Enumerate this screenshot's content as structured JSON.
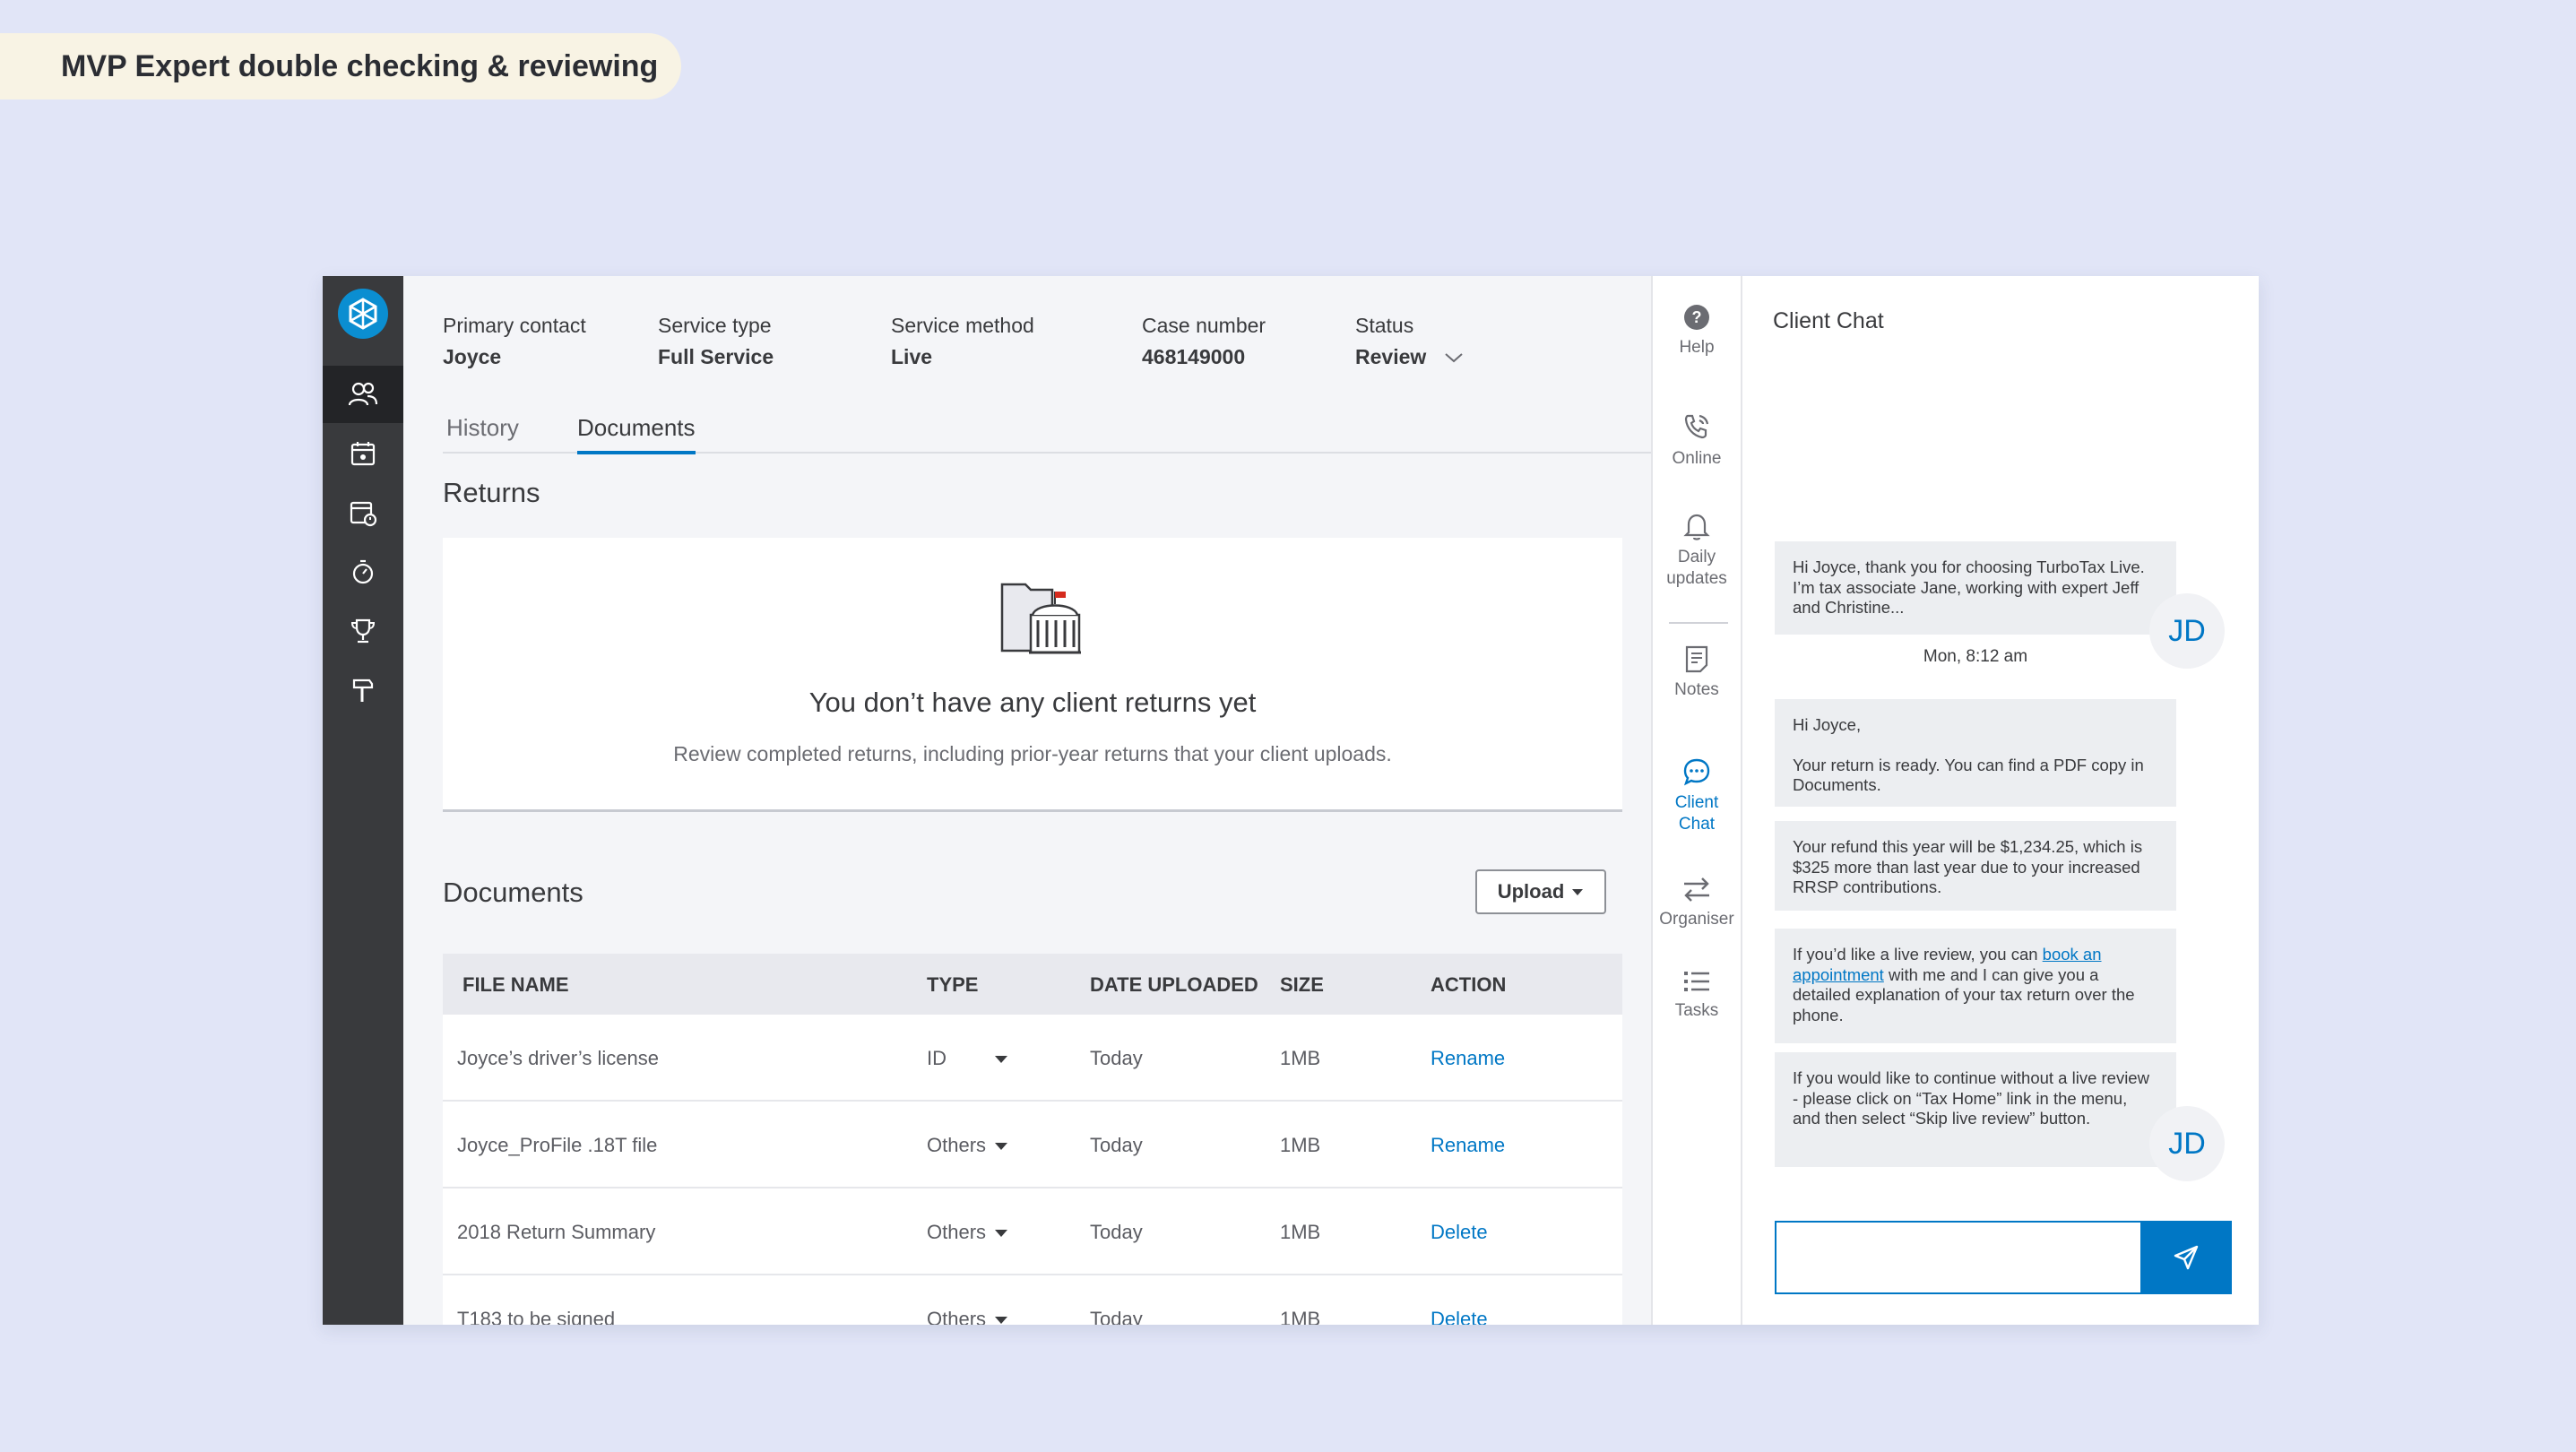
{
  "banner": {
    "text": "MVP  Expert double checking & reviewing"
  },
  "header": {
    "primary_contact": {
      "label": "Primary contact",
      "value": "Joyce"
    },
    "service_type": {
      "label": "Service type",
      "value": "Full Service"
    },
    "service_method": {
      "label": "Service method",
      "value": "Live"
    },
    "case_number": {
      "label": "Case number",
      "value": "468149000"
    },
    "status": {
      "label": "Status",
      "value": "Review"
    }
  },
  "tabs": [
    {
      "label": "History"
    },
    {
      "label": "Documents"
    }
  ],
  "returns": {
    "title": "Returns",
    "empty_title": "You don’t have any client returns yet",
    "empty_sub": "Review completed returns, including prior-year returns that your client uploads."
  },
  "documents": {
    "title": "Documents",
    "upload_label": "Upload",
    "columns": [
      "FILE NAME",
      "TYPE",
      "DATE UPLOADED",
      "SIZE",
      "ACTION"
    ],
    "rows": [
      {
        "name": "Joyce’s driver’s license",
        "type": "ID",
        "date": "Today",
        "size": "1MB",
        "action": "Rename"
      },
      {
        "name": "Joyce_ProFile .18T file",
        "type": "Others",
        "date": "Today",
        "size": "1MB",
        "action": "Rename"
      },
      {
        "name": "2018 Return Summary",
        "type": "Others",
        "date": "Today",
        "size": "1MB",
        "action": "Delete"
      },
      {
        "name": "T183 to be signed",
        "type": "Others",
        "date": "Today",
        "size": "1MB",
        "action": "Delete"
      }
    ]
  },
  "rail": {
    "help": "Help",
    "online": "Online",
    "daily_1": "Daily",
    "daily_2": "updates",
    "notes": "Notes",
    "chat_1": "Client",
    "chat_2": "Chat",
    "organiser": "Organiser",
    "tasks": "Tasks"
  },
  "chat": {
    "title": "Client Chat",
    "avatar": "JD",
    "timestamp": "Mon, 8:12 am",
    "msg1": "Hi Joyce, thank you for choosing TurboTax Live. I’m tax associate Jane, working with expert Jeff and Christine...",
    "msg2_line1": "Hi Joyce,",
    "msg2_line2": "Your return is ready. You can find a PDF copy in Documents.",
    "msg3": "Your refund this year will be $1,234.25, which is $325 more than last year due to your increased RRSP contributions.",
    "msg4_pre": "If you’d like a live review, you can ",
    "msg4_link": "book an appointment",
    "msg4_post": " with me and I can give you a detailed explanation of your tax return over the phone.",
    "msg5": "If you would like to continue without a live review - please click on “Tax Home” link in the menu, and then select “Skip live review” button.",
    "input_value": ""
  },
  "colors": {
    "accent": "#0077c5",
    "nav_bg": "#393a3d",
    "background": "#e1e5f7"
  }
}
